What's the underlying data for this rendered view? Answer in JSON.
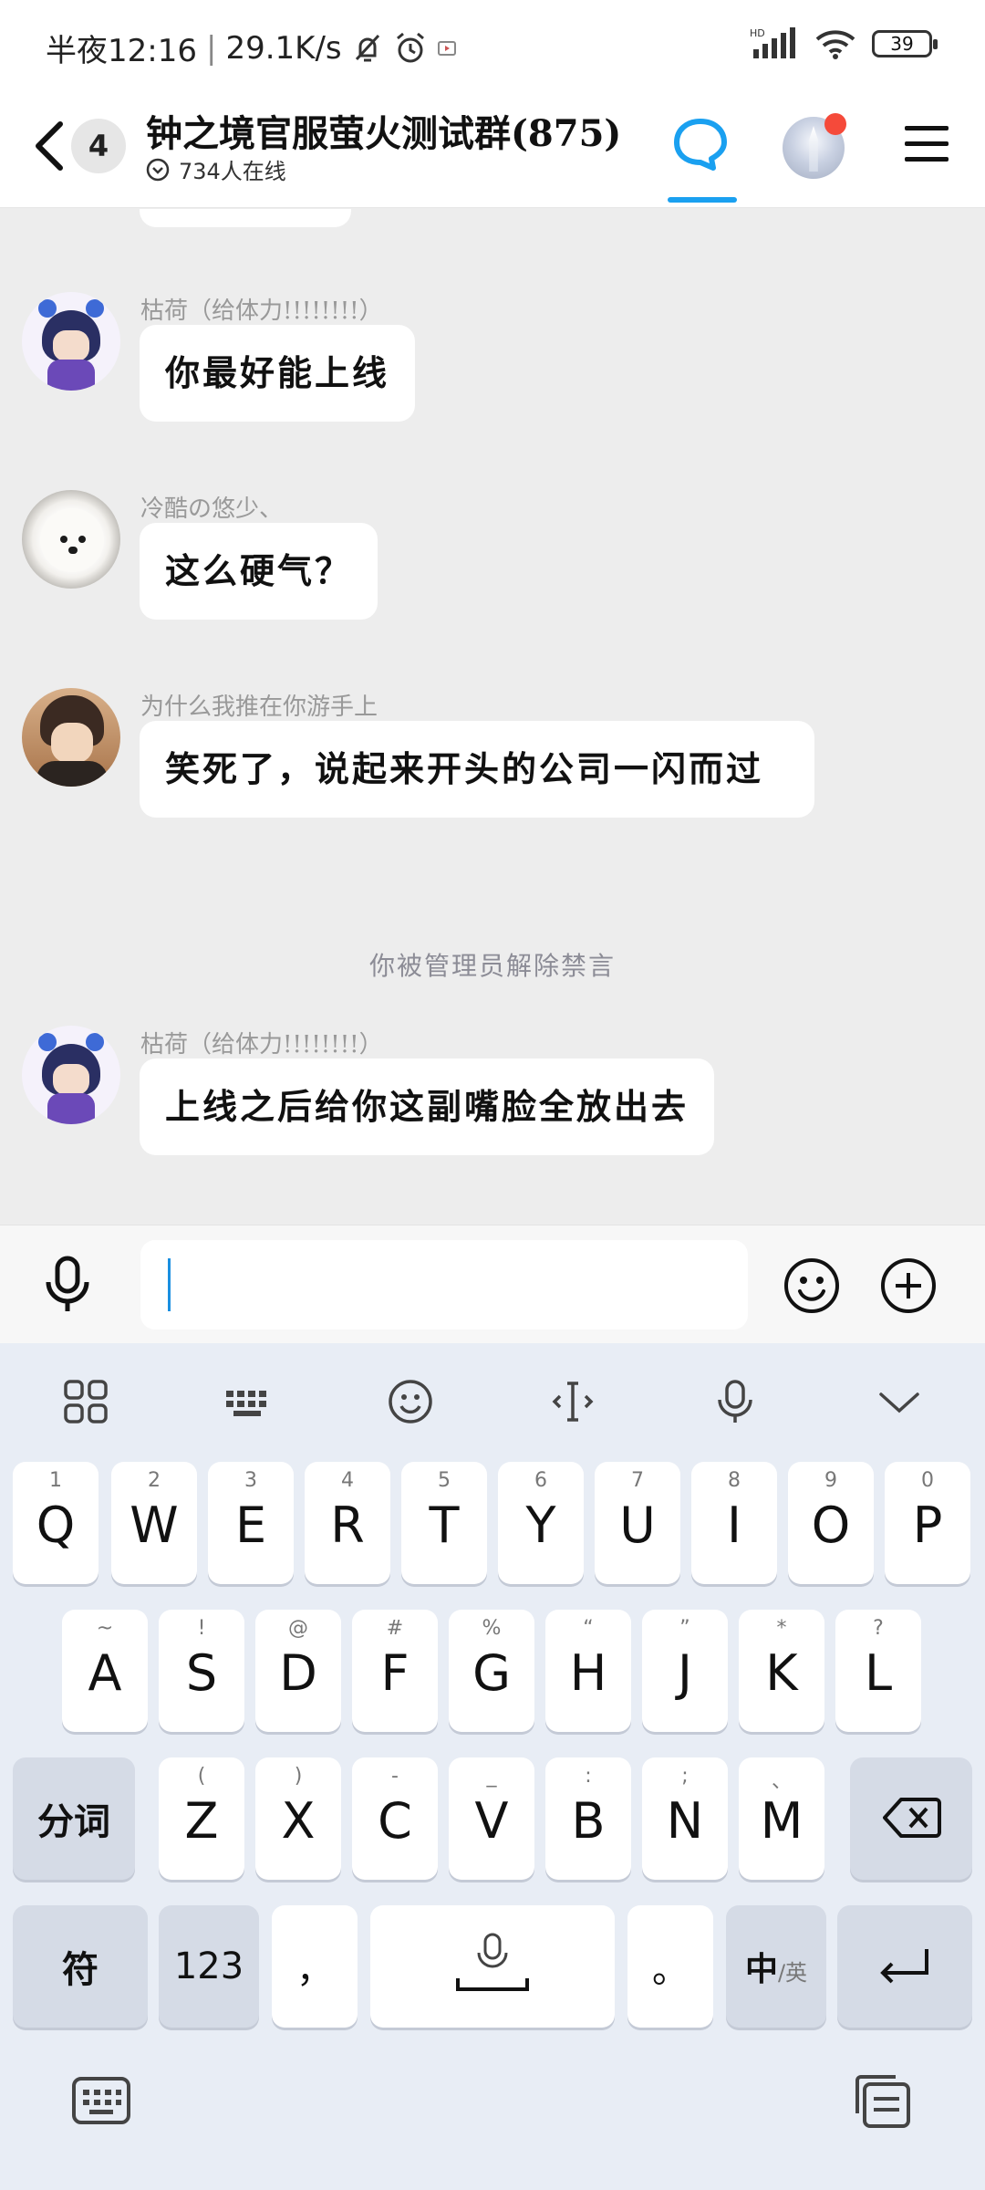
{
  "status_bar": {
    "time": "半夜12:16",
    "network_speed": "29.1K/s",
    "hd": "HD",
    "battery": "39"
  },
  "header": {
    "unread_count": "4",
    "title": "钟之境官服萤火测试群(875)",
    "online_count": "734人在线"
  },
  "messages": [
    {
      "sender": "",
      "text": "",
      "partial": true
    },
    {
      "sender": "枯荷（给体力!!!!!!!!）",
      "text": "你最好能上线",
      "avatar": "anime-avatar"
    },
    {
      "sender": "冷酷の悠少、",
      "text": "这么硬气？",
      "avatar": "dog-avatar"
    },
    {
      "sender": "为什么我推在你游手上",
      "text": "笑死了，说起来开头的公司一闪而过",
      "avatar": "boy-avatar"
    },
    {
      "sender": "枯荷（给体力!!!!!!!!）",
      "text": "上线之后给你这副嘴脸全放出去",
      "avatar": "anime-avatar"
    }
  ],
  "system_message": "你被管理员解除禁言",
  "input": {
    "value": "",
    "placeholder": ""
  },
  "keyboard": {
    "row1": [
      {
        "key": "Q",
        "sub": "1"
      },
      {
        "key": "W",
        "sub": "2"
      },
      {
        "key": "E",
        "sub": "3"
      },
      {
        "key": "R",
        "sub": "4"
      },
      {
        "key": "T",
        "sub": "5"
      },
      {
        "key": "Y",
        "sub": "6"
      },
      {
        "key": "U",
        "sub": "7"
      },
      {
        "key": "I",
        "sub": "8"
      },
      {
        "key": "O",
        "sub": "9"
      },
      {
        "key": "P",
        "sub": "0"
      }
    ],
    "row2": [
      {
        "key": "A",
        "sub": "~"
      },
      {
        "key": "S",
        "sub": "!"
      },
      {
        "key": "D",
        "sub": "@"
      },
      {
        "key": "F",
        "sub": "#"
      },
      {
        "key": "G",
        "sub": "%"
      },
      {
        "key": "H",
        "sub": "“"
      },
      {
        "key": "J",
        "sub": "”"
      },
      {
        "key": "K",
        "sub": "*"
      },
      {
        "key": "L",
        "sub": "?"
      }
    ],
    "row3": [
      {
        "key": "Z",
        "sub": "("
      },
      {
        "key": "X",
        "sub": ")"
      },
      {
        "key": "C",
        "sub": "-"
      },
      {
        "key": "V",
        "sub": "_"
      },
      {
        "key": "B",
        "sub": ":"
      },
      {
        "key": "N",
        "sub": ";"
      },
      {
        "key": "M",
        "sub": "、"
      }
    ],
    "segment_label": "分词",
    "symbol_label": "符",
    "numbers_label": "123",
    "comma_label": "，",
    "period_label": "。",
    "lang_main": "中",
    "lang_sub": "/英"
  }
}
